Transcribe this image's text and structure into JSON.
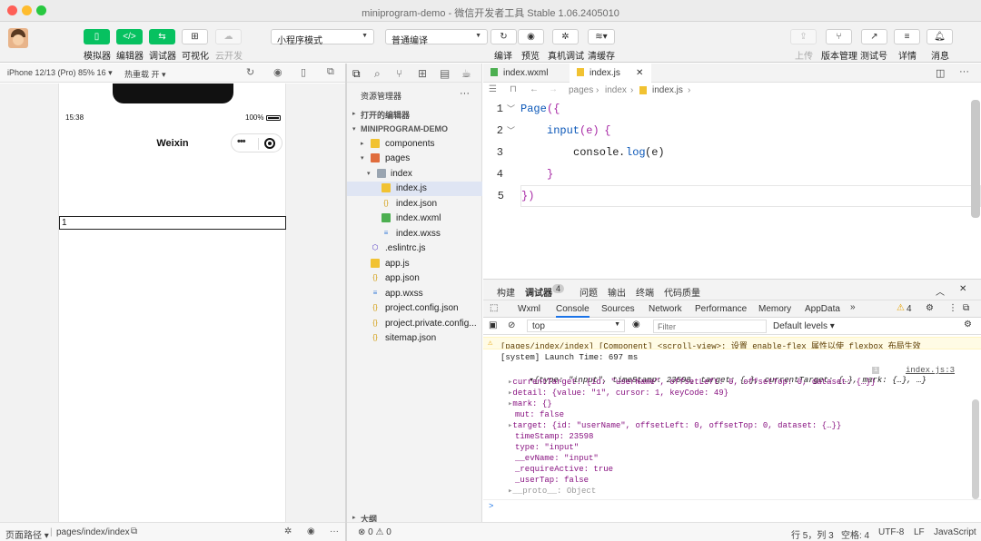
{
  "window": {
    "title": "miniprogram-demo - 微信开发者工具 Stable 1.06.2405010"
  },
  "toolbar": {
    "left_buttons": [
      {
        "label": "模拟器",
        "icon": "phone-icon"
      },
      {
        "label": "编辑器",
        "icon": "code-icon"
      },
      {
        "label": "调试器",
        "icon": "debug-icon"
      },
      {
        "label": "可视化",
        "icon": "layout-icon"
      },
      {
        "label": "云开发",
        "icon": "cloud-icon"
      }
    ],
    "mode_select": "小程序模式",
    "compile_select": "普通编译",
    "center_buttons": [
      {
        "label": "编译",
        "icon": "refresh-icon"
      },
      {
        "label": "预览",
        "icon": "eye-icon"
      },
      {
        "label": "真机调试",
        "icon": "bug-icon"
      },
      {
        "label": "清缓存",
        "icon": "layers-icon"
      }
    ],
    "right_buttons": [
      {
        "label": "上传",
        "icon": "upload-icon"
      },
      {
        "label": "版本管理",
        "icon": "branch-icon"
      },
      {
        "label": "测试号",
        "icon": "external-icon"
      },
      {
        "label": "详情",
        "icon": "menu-icon"
      },
      {
        "label": "消息",
        "icon": "bell-icon"
      }
    ]
  },
  "simulator": {
    "device": "iPhone 12/13 (Pro) 85% 16 ▾",
    "hotreload": "热重载 开 ▾",
    "time": "15:38",
    "battery": "100%",
    "nav_title": "Weixin",
    "capsule_dots": "•••",
    "input_value": "1",
    "footer_label": "页面路径 ▾",
    "footer_path": "pages/index/index"
  },
  "explorer": {
    "title": "资源管理器",
    "more": "···",
    "open_editors": "打开的编辑器",
    "project": "MINIPROGRAM-DEMO",
    "outline": "大纲",
    "tree": [
      {
        "name": "components"
      },
      {
        "name": "pages"
      },
      {
        "name": "index"
      },
      {
        "name": "index.js"
      },
      {
        "name": "index.json"
      },
      {
        "name": "index.wxml"
      },
      {
        "name": "index.wxss"
      },
      {
        "name": ".eslintrc.js"
      },
      {
        "name": "app.js"
      },
      {
        "name": "app.json"
      },
      {
        "name": "app.wxss"
      },
      {
        "name": "project.config.json"
      },
      {
        "name": "project.private.config..."
      },
      {
        "name": "sitemap.json"
      }
    ]
  },
  "editor": {
    "tabs": [
      {
        "label": "index.wxml"
      },
      {
        "label": "index.js"
      }
    ],
    "close": "✕",
    "breadcrumb": [
      "pages",
      "index",
      "index.js"
    ],
    "lines": [
      {
        "num": "1",
        "t1": "Page",
        "t2": "({",
        "t3": "",
        "t4": ""
      },
      {
        "num": "2",
        "t1": "input",
        "t2": "(e)",
        "t3": " {",
        "t4": ""
      },
      {
        "num": "3",
        "t1": "console",
        "t2": ".",
        "t3": "log",
        "t4": "(e)"
      },
      {
        "num": "4",
        "t1": "}",
        "t2": "",
        "t3": "",
        "t4": ""
      },
      {
        "num": "5",
        "t1": "})",
        "t2": "",
        "t3": "",
        "t4": ""
      }
    ]
  },
  "debugger": {
    "top_tabs": [
      "构建",
      "调试器",
      "问题",
      "输出",
      "终端",
      "代码质量"
    ],
    "badge": "4",
    "sub_tabs": [
      "Wxml",
      "Console",
      "Sources",
      "Network",
      "Performance",
      "Memory",
      "AppData"
    ],
    "more_tabs": "»",
    "warn_count": "4",
    "context": "top",
    "filter_placeholder": "Filter",
    "levels": "Default levels ▾",
    "warning": "[pages/index/index] [Component] <scroll-view>: 设置 enable-flex 属性以使 flexbox 布局生效",
    "launch": "[system] Launch Time: 697 ms",
    "obj_summary": "{type: \"input\", timeStamp: 23598, target: {…}, currentTarget: {…}, mark: {…}, …}",
    "source_link": "index.js:3",
    "props": [
      "currentTarget: {id: \"userName\", offsetLeft: 0, offsetTop: 0, dataset: {…}}",
      "detail: {value: \"1\", cursor: 1, keyCode: 49}",
      "mark: {}",
      "mut: false",
      "target: {id: \"userName\", offsetLeft: 0, offsetTop: 0, dataset: {…}}",
      "timeStamp: 23598",
      "type: \"input\"",
      "__evName: \"input\"",
      "_requireActive: true",
      "_userTap: false",
      "__proto__: Object"
    ],
    "prompt": ">"
  },
  "statusbar": {
    "problems": "⊗ 0 ⚠ 0",
    "position": "行 5，列 3",
    "spaces": "空格: 4",
    "encoding": "UTF-8",
    "eol": "LF",
    "lang": "JavaScript"
  }
}
